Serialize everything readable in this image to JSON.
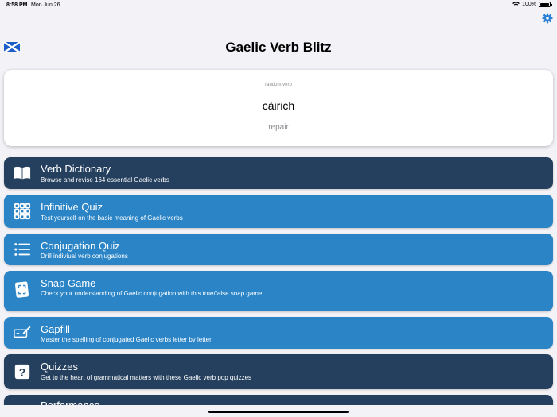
{
  "status": {
    "time": "8:58 PM",
    "date": "Mon Jun 26",
    "battery": "100%"
  },
  "header": {
    "title": "Gaelic Verb Blitz",
    "flag_icon": "scottish-saltire-icon",
    "settings_icon": "gear-icon"
  },
  "random_verb": {
    "label": "random verb",
    "word": "càirich",
    "meaning": "repair"
  },
  "menu": [
    {
      "title": "Verb Dictionary",
      "description": "Browse and revise 164 essential Gaelic verbs",
      "icon": "book-icon",
      "style": "dark"
    },
    {
      "title": "Infinitive Quiz",
      "description": "Test yourself on the basic meaning of Gaelic verbs",
      "icon": "grid-icon",
      "style": "blue"
    },
    {
      "title": "Conjugation Quiz",
      "description": "Drill indiviual verb conjugations",
      "icon": "list-icon",
      "style": "blue"
    },
    {
      "title": "Snap Game",
      "description": "Check your understanding of Gaelic conjugation with this true/false snap game",
      "icon": "cards-icon",
      "style": "blue"
    },
    {
      "title": "Gapfill",
      "description": "Master the spelling of conjugated Gaelic verbs letter by letter",
      "icon": "pencil-field-icon",
      "style": "blue"
    },
    {
      "title": "Quizzes",
      "description": "Get to the heart of grammatical matters with these Gaelic verb pop quizzes",
      "icon": "question-icon",
      "style": "dark"
    },
    {
      "title": "Performance",
      "description": "",
      "icon": "chart-icon",
      "style": "dark"
    }
  ],
  "colors": {
    "dark": "#25405e",
    "blue": "#2a84c6",
    "background": "#f2f2f7",
    "settings_accent": "#2a7fd4"
  }
}
